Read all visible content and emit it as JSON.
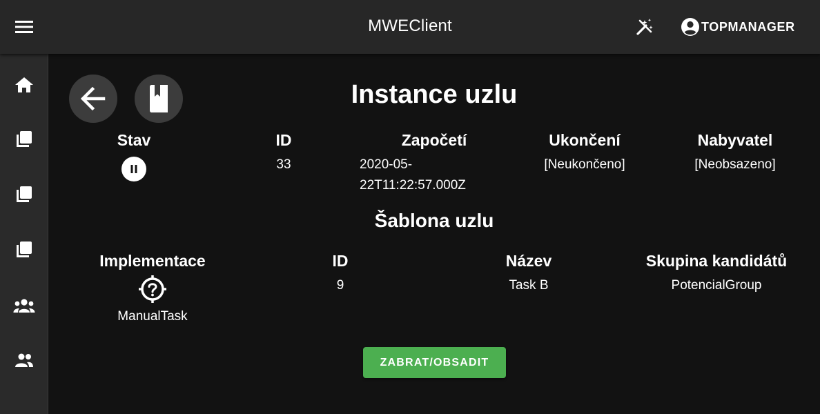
{
  "app": {
    "title": "MWEClient"
  },
  "header": {
    "user_name": "TOPMANAGER"
  },
  "sidebar": {
    "items": [
      {
        "icon": "home-icon"
      },
      {
        "icon": "library-books-icon"
      },
      {
        "icon": "library-books-icon"
      },
      {
        "icon": "library-books-icon"
      },
      {
        "icon": "groups-icon"
      },
      {
        "icon": "people-icon"
      }
    ]
  },
  "page": {
    "title": "Instance uzlu"
  },
  "instance": {
    "headers": {
      "state": "Stav",
      "id": "ID",
      "start": "Započetí",
      "end": "Ukončení",
      "assignee": "Nabyvatel"
    },
    "values": {
      "state_icon": "pause-icon",
      "id": "33",
      "start_line1": "2020-05-",
      "start_line2": "22T11:22:57.000Z",
      "end": "[Neukončeno]",
      "assignee": "[Neobsazeno]"
    }
  },
  "template": {
    "title": "Šablona uzlu",
    "headers": {
      "implementation": "Implementace",
      "id": "ID",
      "name": "Název",
      "candidate_group": "Skupina kandidátů"
    },
    "values": {
      "implementation_icon": "help-target-icon",
      "implementation": "ManualTask",
      "id": "9",
      "name": "Task B",
      "candidate_group": "PotencialGroup"
    }
  },
  "actions": {
    "claim_label": "ZABRAT/OBSADIT"
  },
  "colors": {
    "background": "#121212",
    "appbar": "#272727",
    "sidebar": "#2a2a2a",
    "accent": "#4caf50",
    "round_button": "#3c3c3c"
  }
}
